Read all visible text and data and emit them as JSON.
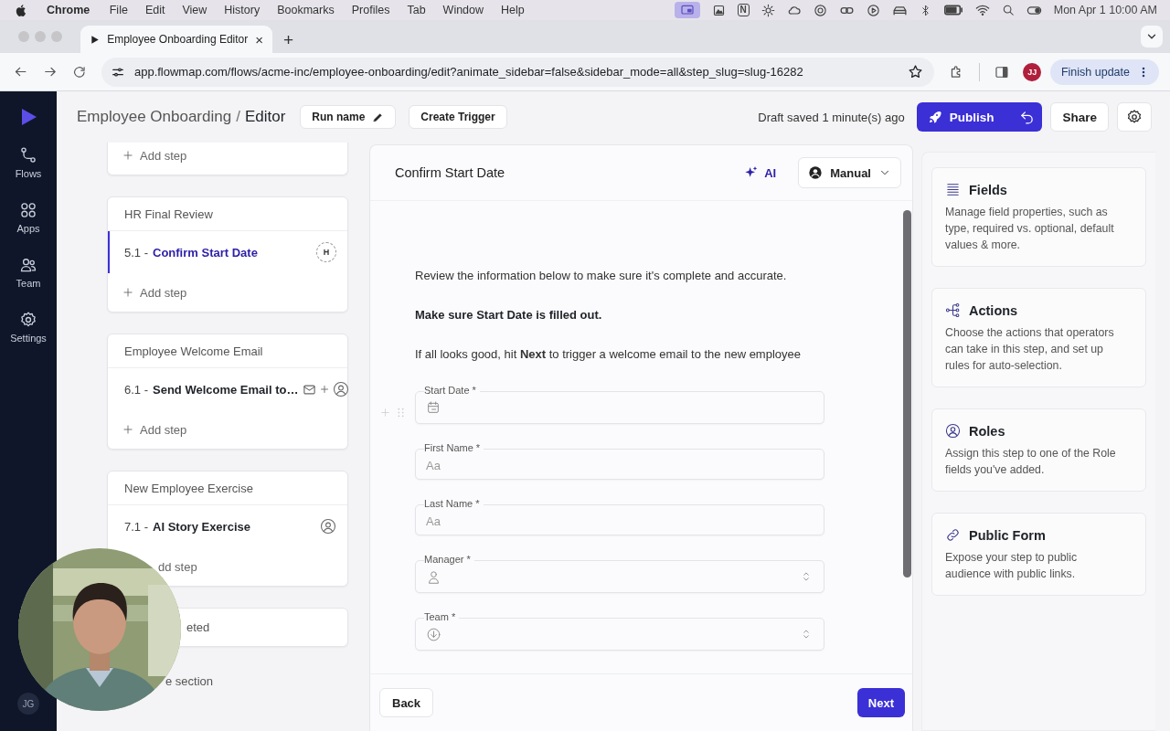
{
  "menu_bar": {
    "app_name": "Chrome",
    "menus": [
      "File",
      "Edit",
      "View",
      "History",
      "Bookmarks",
      "Profiles",
      "Tab",
      "Window",
      "Help"
    ],
    "status_letter": "N",
    "clock": "Mon Apr 1  10:00 AM"
  },
  "browser": {
    "tab": {
      "title": "Employee Onboarding Editor",
      "close": "×"
    },
    "new_tab": "+",
    "address": "app.flowmap.com/flows/acme-inc/employee-onboarding/edit?animate_sidebar=false&sidebar_mode=all&step_slug=slug-16282",
    "profile_initials": "JJ",
    "update_button": "Finish update"
  },
  "sidebar": {
    "items": [
      {
        "label": "Flows",
        "kind": "flows",
        "selected": false
      },
      {
        "label": "Apps",
        "kind": "apps",
        "selected": false
      },
      {
        "label": "Team",
        "kind": "team",
        "selected": false
      },
      {
        "label": "Settings",
        "kind": "settings",
        "selected": false
      }
    ],
    "user_initials": "JG"
  },
  "header": {
    "flow_name": "Employee Onboarding",
    "separator": "/",
    "page": "Editor",
    "run_name_button": "Run name",
    "trigger_button": "Create Trigger",
    "save_status": "Draft saved 1 minute(s) ago",
    "publish_button": "Publish",
    "share_button": "Share"
  },
  "sections": [
    {
      "kind": "card",
      "add_step": {
        "label": "Add step",
        "plus": true
      }
    },
    {
      "kind": "card",
      "title": "HR Final Review",
      "steps": [
        {
          "number": "5.1 -",
          "name": "Confirm Start Date",
          "selected": true,
          "kind": "badge",
          "badge": "H"
        }
      ],
      "add_step": {
        "label": "Add step",
        "plus": true
      }
    },
    {
      "kind": "card",
      "title": "Employee Welcome Email",
      "steps": [
        {
          "number": "6.1 -",
          "name": "Send Welcome Email to…",
          "selected": false,
          "kind": "email"
        }
      ],
      "add_step": {
        "label": "Add step",
        "plus": true
      }
    },
    {
      "kind": "card",
      "title": "New Employee Exercise",
      "steps": [
        {
          "number": "7.1 -",
          "name": "AI Story Exercise",
          "selected": false,
          "kind": "person"
        }
      ],
      "add_step": {
        "label": "dd step",
        "plus": false
      }
    },
    {
      "kind": "card",
      "title": "eted"
    },
    {
      "kind": "add_section",
      "label": "e section"
    }
  ],
  "step_panel": {
    "title": "Confirm Start Date",
    "ai_button": "AI",
    "mode_dropdown": "Manual",
    "paragraphs": [
      {
        "text": "Review the information below to make sure it's complete and accurate.",
        "bold": false
      },
      {
        "text": "Make sure Start Date is filled out.",
        "bold": true
      },
      {
        "text": "If all looks good, hit **Next** to trigger a welcome email to the new employee",
        "bold": false
      }
    ],
    "fields": [
      {
        "label": "Start Date *",
        "kind": "date",
        "hovered": true
      },
      {
        "label": "First Name *",
        "kind": "text",
        "placeholder": "Aa",
        "hovered": false
      },
      {
        "label": "Last Name *",
        "kind": "text",
        "placeholder": "Aa",
        "hovered": false
      },
      {
        "label": "Manager *",
        "kind": "person",
        "hovered": false
      },
      {
        "label": "Team *",
        "kind": "select",
        "hovered": false
      }
    ],
    "back_button": "Back",
    "next_button": "Next"
  },
  "tools": [
    {
      "kind": "fields",
      "title": "Fields",
      "description": "Manage field properties, such as type, required vs. optional, default values & more."
    },
    {
      "kind": "actions",
      "title": "Actions",
      "description": "Choose the actions that operators can take in this step, and set up rules for auto-selection."
    },
    {
      "kind": "roles",
      "title": "Roles",
      "description": "Assign this step to one of the Role fields you've added."
    },
    {
      "kind": "public_form",
      "title": "Public Form",
      "description": "Expose your step to public audience with public links."
    }
  ]
}
